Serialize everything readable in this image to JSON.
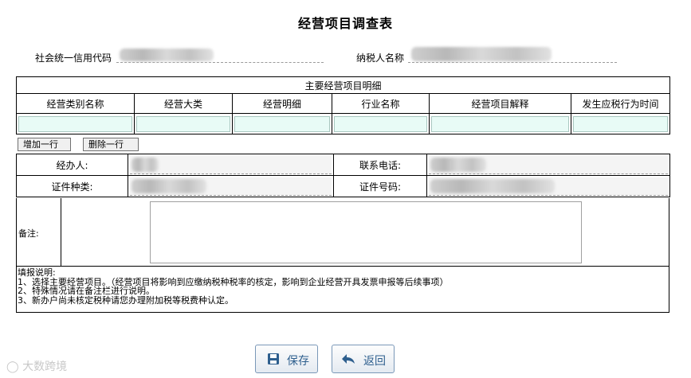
{
  "page": {
    "title": "经营项目调查表"
  },
  "taxpayer": {
    "credit_code_label": "社会统一信用代码",
    "name_label": "纳税人名称"
  },
  "business_table": {
    "caption": "主要经营项目明细",
    "columns": [
      "经营类别名称",
      "经营大类",
      "经营明细",
      "行业名称",
      "经营项目解释",
      "发生应税行为时间"
    ],
    "rows": [
      [
        "",
        "",
        "",
        "",
        "",
        ""
      ]
    ],
    "add_row_label": "增加一行",
    "delete_row_label": "删除一行"
  },
  "contact": {
    "handler_label": "经办人:",
    "phone_label": "联系电话:",
    "id_type_label": "证件种类:",
    "id_number_label": "证件号码:"
  },
  "remarks": {
    "label": "备注:",
    "value": ""
  },
  "instructions": {
    "title": "填报说明:",
    "lines": [
      "1、选择主要经营项目。（经营项目将影响到应缴纳税种税率的核定，影响到企业经营开具发票申报等后续事项）",
      "2、特殊情况请在备注栏进行说明。",
      "3、新办户尚未核定税种请您办理附加税等税费种认定。"
    ]
  },
  "actions": {
    "save_label": "保存",
    "back_label": "返回"
  },
  "watermark": {
    "text": "大数跨境"
  },
  "colors": {
    "input_bg": "#e8fbf6",
    "button_text": "#2e5f8e",
    "button_border": "#7a98b8"
  }
}
